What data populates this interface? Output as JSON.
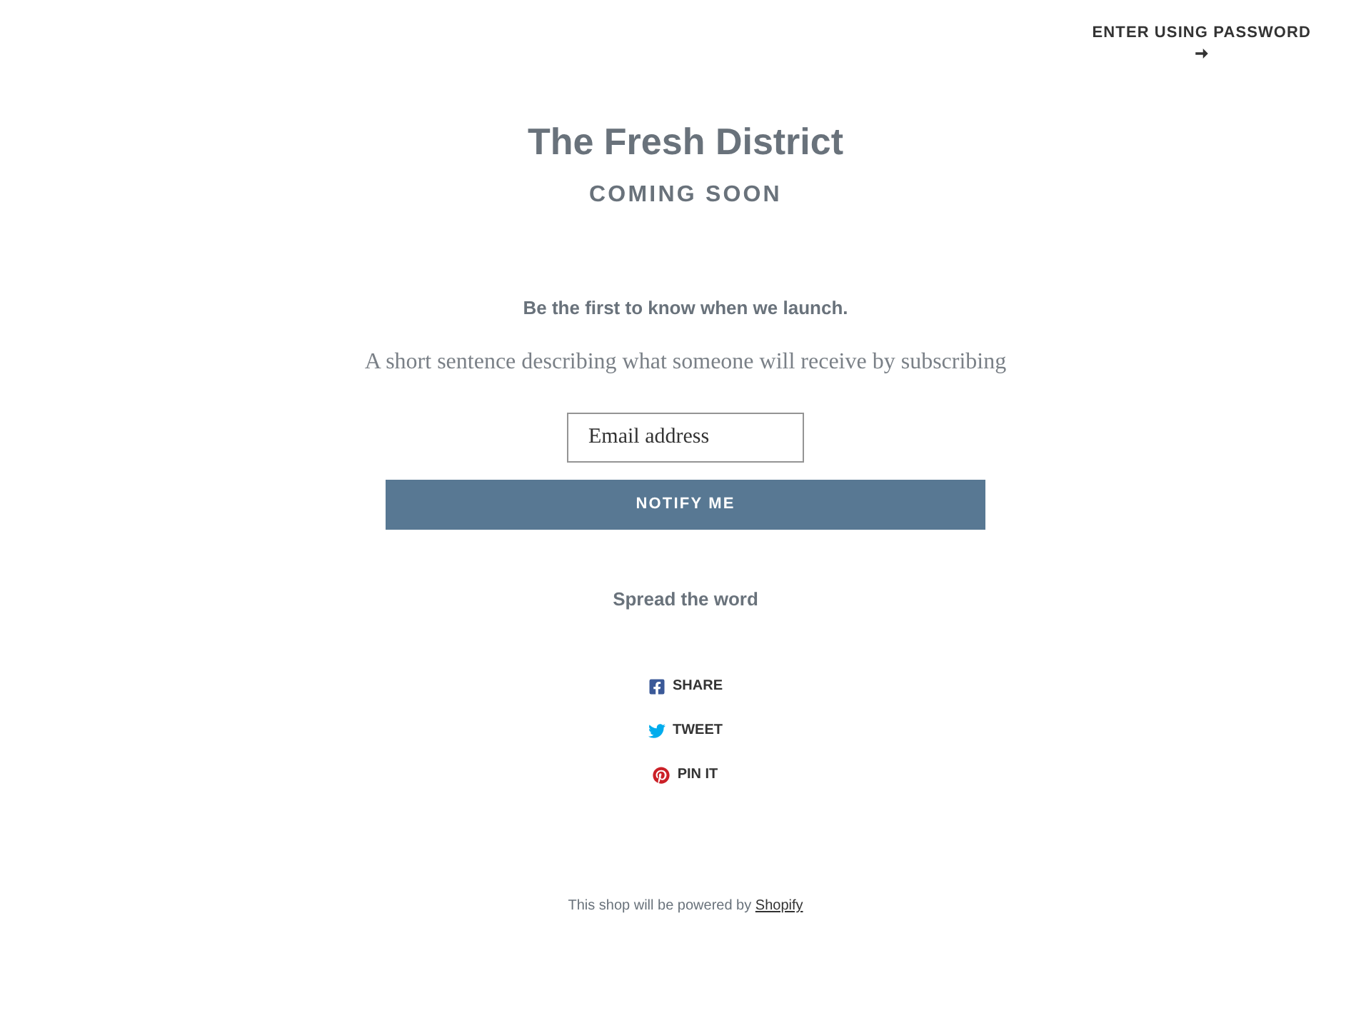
{
  "password_link": {
    "label": "ENTER USING PASSWORD"
  },
  "shop": {
    "title": "The Fresh District",
    "tagline": "COMING SOON"
  },
  "signup": {
    "heading": "Be the first to know when we launch.",
    "description": "A short sentence describing what someone will receive by subscribing",
    "email": {
      "placeholder": "Email address"
    },
    "button": "NOTIFY ME"
  },
  "share": {
    "heading": "Spread the word",
    "links": [
      {
        "kind": "facebook",
        "label": "SHARE"
      },
      {
        "kind": "twitter",
        "label": "TWEET"
      },
      {
        "kind": "pinterest",
        "label": "PIN IT"
      }
    ]
  },
  "footer": {
    "text": "This shop will be powered by",
    "link": "Shopify"
  }
}
